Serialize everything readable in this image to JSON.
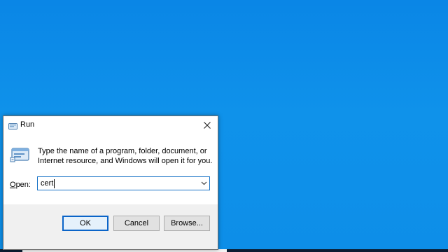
{
  "window": {
    "title": "Run"
  },
  "dialog": {
    "description": "Type the name of a program, folder, document, or Internet resource, and Windows will open it for you.",
    "open_label_prefix": "O",
    "open_label_rest": "pen:",
    "open_value": "cert",
    "ok_label": "OK",
    "cancel_label": "Cancel",
    "browse_label": "Browse..."
  },
  "icons": {
    "title": "run-app-icon",
    "close": "close-icon",
    "run": "run-icon",
    "dropdown": "chevron-down-icon"
  },
  "colors": {
    "desktop": "#0f92ea",
    "focus_border": "#1a74c7",
    "default_button_border": "#0a64c8"
  }
}
